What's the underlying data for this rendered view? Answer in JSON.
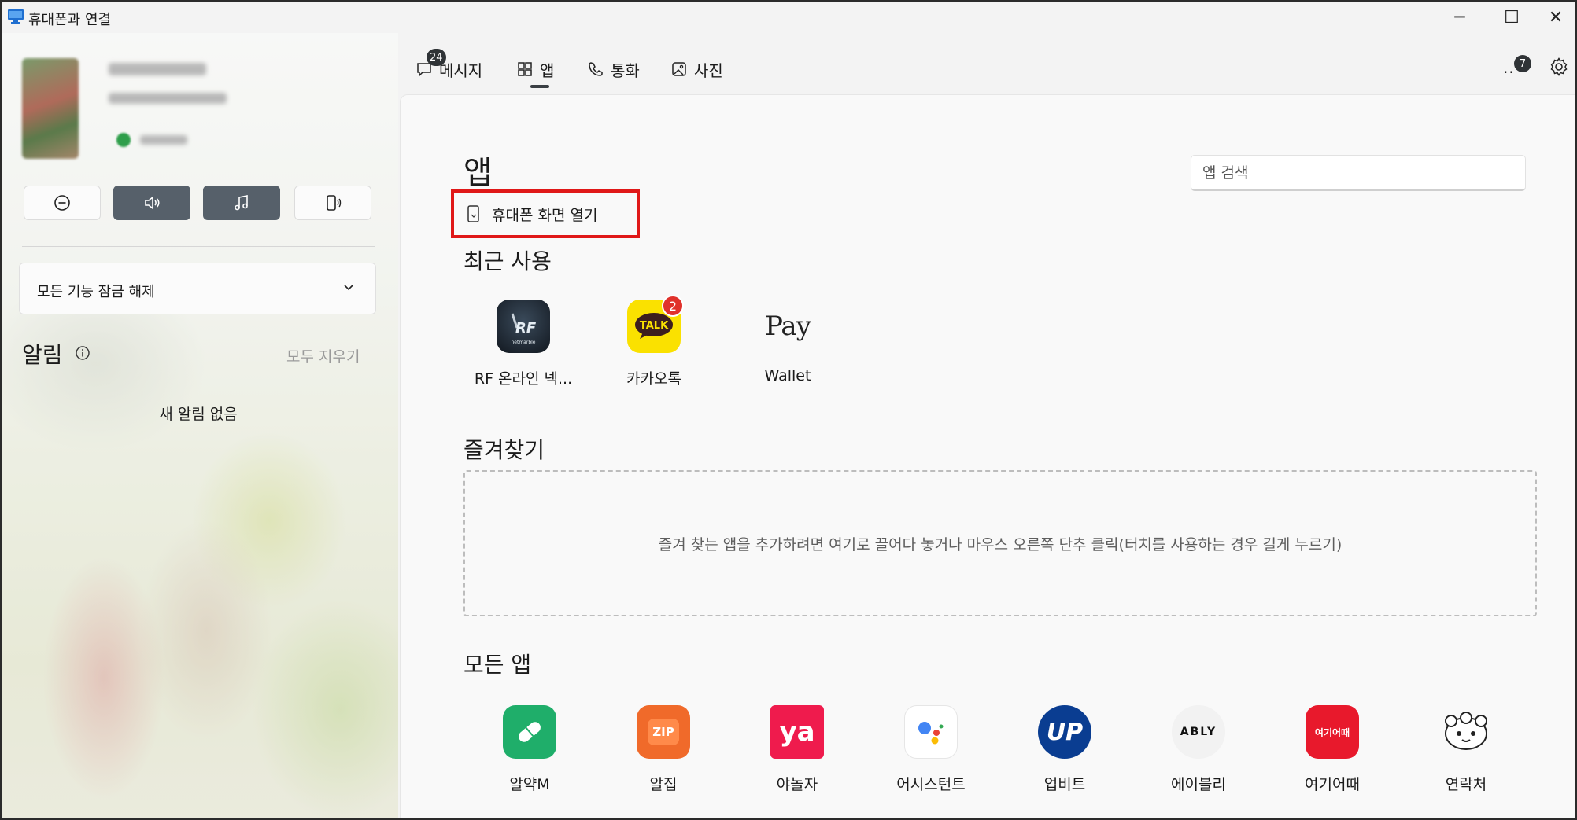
{
  "window": {
    "title": "휴대폰과 연결",
    "minimize": "─",
    "maximize": "☐",
    "close": "✕"
  },
  "left": {
    "controls": [
      {
        "name": "do-not-disturb",
        "icon": "minus-circle-icon"
      },
      {
        "name": "sound",
        "icon": "speaker-icon"
      },
      {
        "name": "media",
        "icon": "music-note-icon"
      },
      {
        "name": "ring-phone",
        "icon": "phone-ring-icon"
      }
    ],
    "unlock_label": "모든 기능 잠금 해제",
    "notifications_title": "알림",
    "clear_all": "모두 지우기",
    "no_notifications": "새 알림 없음"
  },
  "nav": {
    "tabs": [
      {
        "label": "메시지",
        "icon": "chat-icon",
        "badge": "24"
      },
      {
        "label": "앱",
        "icon": "apps-icon",
        "active": true
      },
      {
        "label": "통화",
        "icon": "phone-icon"
      },
      {
        "label": "사진",
        "icon": "photo-icon"
      }
    ],
    "more": "..",
    "more_badge": "7"
  },
  "main": {
    "title": "앱",
    "search_placeholder": "앱 검색",
    "open_phone_screen": "휴대폰 화면 열기",
    "recent_title": "최근 사용",
    "recent_apps": [
      {
        "label": "RF 온라인 넥...",
        "icon": "rf-online-icon"
      },
      {
        "label": "카카오톡",
        "icon": "kakaotalk-icon",
        "badge": "2",
        "icon_text": "TALK"
      },
      {
        "label": "Wallet",
        "icon": "samsung-pay-icon",
        "icon_text": "Pay"
      }
    ],
    "favorites_title": "즐겨찾기",
    "favorites_hint": "즐겨 찾는 앱을 추가하려면 여기로 끌어다 놓거나 마우스 오른쪽 단추 클릭(터치를 사용하는 경우 길게 누르기)",
    "all_title": "모든 앱",
    "all_apps": [
      {
        "label": "알약M",
        "icon": "alyac-icon",
        "color": "#1fae6a"
      },
      {
        "label": "알집",
        "icon": "alzip-icon",
        "color": "#f06a2a",
        "icon_text": "ZIP"
      },
      {
        "label": "야놀자",
        "icon": "yanolja-icon",
        "color": "#ef1b4d",
        "icon_text": "ya"
      },
      {
        "label": "어시스턴트",
        "icon": "google-assistant-icon",
        "color": "#ffffff"
      },
      {
        "label": "업비트",
        "icon": "upbit-icon",
        "color": "#0a3d91",
        "icon_text": "UP"
      },
      {
        "label": "에이블리",
        "icon": "ably-icon",
        "color": "#f2f2f2",
        "icon_text": "ABLY"
      },
      {
        "label": "여기어때",
        "icon": "yeogi-icon",
        "color": "#e8192c",
        "icon_text": "여기어때"
      },
      {
        "label": "연락처",
        "icon": "contacts-icon",
        "color": "#ffffff"
      }
    ]
  }
}
